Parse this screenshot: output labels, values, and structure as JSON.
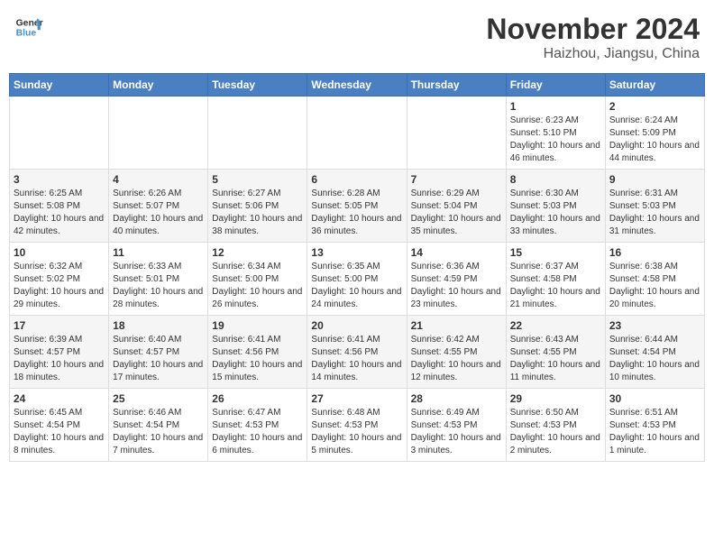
{
  "header": {
    "logo_line1": "General",
    "logo_line2": "Blue",
    "title": "November 2024",
    "subtitle": "Haizhou, Jiangsu, China"
  },
  "days_of_week": [
    "Sunday",
    "Monday",
    "Tuesday",
    "Wednesday",
    "Thursday",
    "Friday",
    "Saturday"
  ],
  "weeks": [
    [
      {
        "num": "",
        "info": ""
      },
      {
        "num": "",
        "info": ""
      },
      {
        "num": "",
        "info": ""
      },
      {
        "num": "",
        "info": ""
      },
      {
        "num": "",
        "info": ""
      },
      {
        "num": "1",
        "info": "Sunrise: 6:23 AM\nSunset: 5:10 PM\nDaylight: 10 hours and 46 minutes."
      },
      {
        "num": "2",
        "info": "Sunrise: 6:24 AM\nSunset: 5:09 PM\nDaylight: 10 hours and 44 minutes."
      }
    ],
    [
      {
        "num": "3",
        "info": "Sunrise: 6:25 AM\nSunset: 5:08 PM\nDaylight: 10 hours and 42 minutes."
      },
      {
        "num": "4",
        "info": "Sunrise: 6:26 AM\nSunset: 5:07 PM\nDaylight: 10 hours and 40 minutes."
      },
      {
        "num": "5",
        "info": "Sunrise: 6:27 AM\nSunset: 5:06 PM\nDaylight: 10 hours and 38 minutes."
      },
      {
        "num": "6",
        "info": "Sunrise: 6:28 AM\nSunset: 5:05 PM\nDaylight: 10 hours and 36 minutes."
      },
      {
        "num": "7",
        "info": "Sunrise: 6:29 AM\nSunset: 5:04 PM\nDaylight: 10 hours and 35 minutes."
      },
      {
        "num": "8",
        "info": "Sunrise: 6:30 AM\nSunset: 5:03 PM\nDaylight: 10 hours and 33 minutes."
      },
      {
        "num": "9",
        "info": "Sunrise: 6:31 AM\nSunset: 5:03 PM\nDaylight: 10 hours and 31 minutes."
      }
    ],
    [
      {
        "num": "10",
        "info": "Sunrise: 6:32 AM\nSunset: 5:02 PM\nDaylight: 10 hours and 29 minutes."
      },
      {
        "num": "11",
        "info": "Sunrise: 6:33 AM\nSunset: 5:01 PM\nDaylight: 10 hours and 28 minutes."
      },
      {
        "num": "12",
        "info": "Sunrise: 6:34 AM\nSunset: 5:00 PM\nDaylight: 10 hours and 26 minutes."
      },
      {
        "num": "13",
        "info": "Sunrise: 6:35 AM\nSunset: 5:00 PM\nDaylight: 10 hours and 24 minutes."
      },
      {
        "num": "14",
        "info": "Sunrise: 6:36 AM\nSunset: 4:59 PM\nDaylight: 10 hours and 23 minutes."
      },
      {
        "num": "15",
        "info": "Sunrise: 6:37 AM\nSunset: 4:58 PM\nDaylight: 10 hours and 21 minutes."
      },
      {
        "num": "16",
        "info": "Sunrise: 6:38 AM\nSunset: 4:58 PM\nDaylight: 10 hours and 20 minutes."
      }
    ],
    [
      {
        "num": "17",
        "info": "Sunrise: 6:39 AM\nSunset: 4:57 PM\nDaylight: 10 hours and 18 minutes."
      },
      {
        "num": "18",
        "info": "Sunrise: 6:40 AM\nSunset: 4:57 PM\nDaylight: 10 hours and 17 minutes."
      },
      {
        "num": "19",
        "info": "Sunrise: 6:41 AM\nSunset: 4:56 PM\nDaylight: 10 hours and 15 minutes."
      },
      {
        "num": "20",
        "info": "Sunrise: 6:41 AM\nSunset: 4:56 PM\nDaylight: 10 hours and 14 minutes."
      },
      {
        "num": "21",
        "info": "Sunrise: 6:42 AM\nSunset: 4:55 PM\nDaylight: 10 hours and 12 minutes."
      },
      {
        "num": "22",
        "info": "Sunrise: 6:43 AM\nSunset: 4:55 PM\nDaylight: 10 hours and 11 minutes."
      },
      {
        "num": "23",
        "info": "Sunrise: 6:44 AM\nSunset: 4:54 PM\nDaylight: 10 hours and 10 minutes."
      }
    ],
    [
      {
        "num": "24",
        "info": "Sunrise: 6:45 AM\nSunset: 4:54 PM\nDaylight: 10 hours and 8 minutes."
      },
      {
        "num": "25",
        "info": "Sunrise: 6:46 AM\nSunset: 4:54 PM\nDaylight: 10 hours and 7 minutes."
      },
      {
        "num": "26",
        "info": "Sunrise: 6:47 AM\nSunset: 4:53 PM\nDaylight: 10 hours and 6 minutes."
      },
      {
        "num": "27",
        "info": "Sunrise: 6:48 AM\nSunset: 4:53 PM\nDaylight: 10 hours and 5 minutes."
      },
      {
        "num": "28",
        "info": "Sunrise: 6:49 AM\nSunset: 4:53 PM\nDaylight: 10 hours and 3 minutes."
      },
      {
        "num": "29",
        "info": "Sunrise: 6:50 AM\nSunset: 4:53 PM\nDaylight: 10 hours and 2 minutes."
      },
      {
        "num": "30",
        "info": "Sunrise: 6:51 AM\nSunset: 4:53 PM\nDaylight: 10 hours and 1 minute."
      }
    ]
  ]
}
